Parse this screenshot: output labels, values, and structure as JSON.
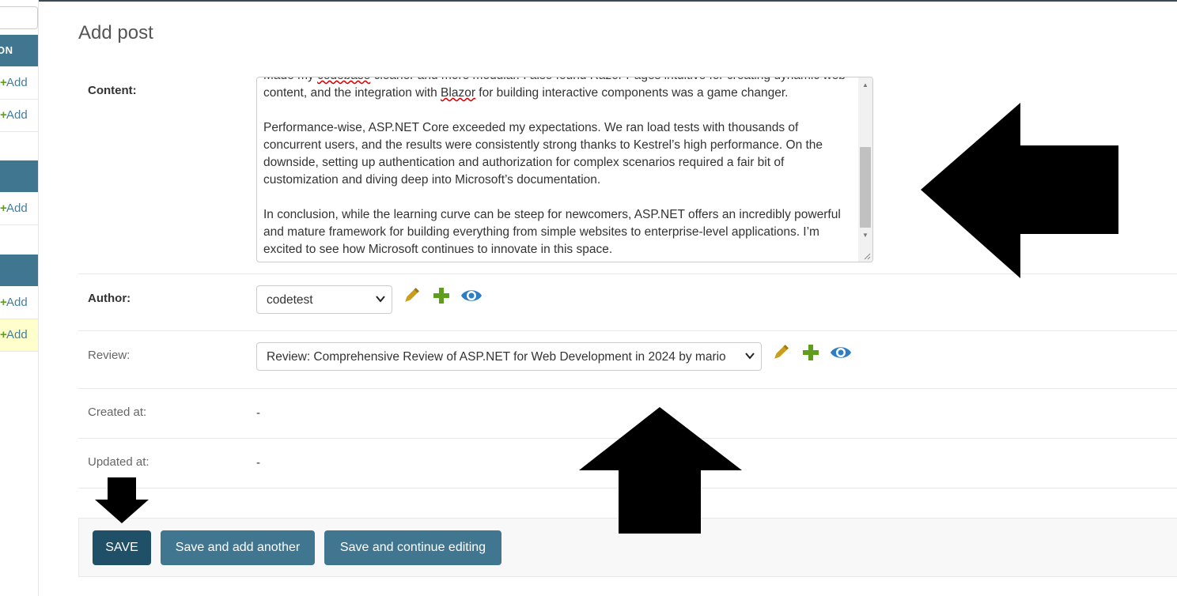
{
  "sidebar": {
    "module_caption_1": "ON",
    "add_label": "Add",
    "plus_glyph": "+"
  },
  "page": {
    "title": "Add post"
  },
  "form": {
    "content": {
      "label": "Content:",
      "text": [
        "Made my codebase cleaner and more modular. I also found Razor Pages intuitive for creating dynamic web content, and the integration with Blazor for building interactive components was a game changer.",
        "Performance-wise, ASP.NET Core exceeded my expectations. We ran load tests with thousands of concurrent users, and the results were consistently strong thanks to Kestrel’s high performance. On the downside, setting up authentication and authorization for complex scenarios required a fair bit of customization and diving deep into Microsoft’s documentation.",
        "In conclusion, while the learning curve can be steep for newcomers, ASP.NET offers an incredibly powerful and mature framework for building everything from simple websites to enterprise-level applications. I’m excited to see how Microsoft continues to innovate in this space."
      ]
    },
    "author": {
      "label": "Author:",
      "selected": "codetest"
    },
    "review": {
      "label": "Review:",
      "selected": "Review: Comprehensive Review of ASP.NET for Web Development in 2024 by mario"
    },
    "created_at": {
      "label": "Created at:",
      "value": "-"
    },
    "updated_at": {
      "label": "Updated at:",
      "value": "-"
    }
  },
  "buttons": {
    "save": "SAVE",
    "save_add_another": "Save and add another",
    "save_continue": "Save and continue editing"
  },
  "colors": {
    "module_caption": "#417690",
    "button": "#417690",
    "default_button": "#205067",
    "pencil_icon": "#c89f1a",
    "add_icon": "#5e9e1c",
    "view_icon": "#2d7ec4",
    "annotation_arrow": "#000000"
  },
  "icons": [
    "pencil-icon",
    "plus-icon",
    "eye-icon",
    "chevron-down-icon"
  ]
}
